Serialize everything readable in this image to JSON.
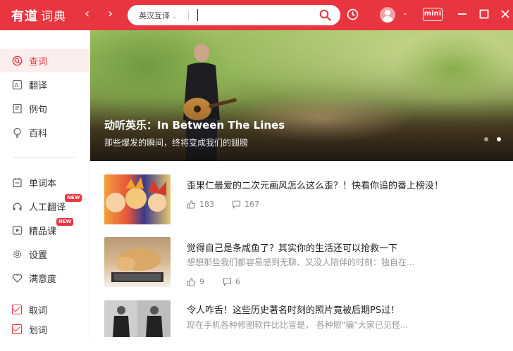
{
  "app": {
    "logo_text": "有道",
    "logo_sub": "词典",
    "back_arrow": "‹",
    "forward_arrow": "›"
  },
  "search": {
    "language": "英汉互译",
    "query": ""
  },
  "toolbar": {
    "mini_label": "mini",
    "user_chevron": "⌄"
  },
  "sidebar": {
    "items": [
      {
        "label": "查词",
        "icon": "search-word-icon",
        "active": true
      },
      {
        "label": "翻译",
        "icon": "translate-icon"
      },
      {
        "label": "例句",
        "icon": "example-icon"
      },
      {
        "label": "百科",
        "icon": "bulb-icon"
      },
      {
        "label": "单词本",
        "icon": "wordbook-icon"
      },
      {
        "label": "人工翻译",
        "icon": "human-translate-icon",
        "badge": "NEW"
      },
      {
        "label": "精品课",
        "icon": "course-icon",
        "badge": "NEW"
      },
      {
        "label": "设置",
        "icon": "gear-icon"
      },
      {
        "label": "满意度",
        "icon": "heart-icon"
      },
      {
        "label": "取词",
        "checked": true
      },
      {
        "label": "划词",
        "checked": true
      }
    ]
  },
  "banner": {
    "title": "动听英乐：In Between The Lines",
    "subtitle": "那些爆发的瞬间，终将变成我们的翅膀",
    "dots": 2,
    "active_dot": 1
  },
  "feed": [
    {
      "title": "歪果仁最爱的二次元画风怎么这么歪？！快看你追的番上榜没！",
      "summary": "",
      "likes": "183",
      "comments": "167"
    },
    {
      "title": "觉得自己是条咸鱼了？其实你的生活还可以抢救一下",
      "summary": "想想那些我们都容易感到无聊、又没人陪伴的时刻：独自在...",
      "likes": "9",
      "comments": "6"
    },
    {
      "title": "令人咋舌！这些历史著名时刻的照片竟被后期PS过！",
      "summary": "现在手机各种修图软件比比皆是， 各种照\"骗\"大家已见怪...",
      "likes": "",
      "comments": ""
    }
  ],
  "colors": {
    "brand": "#e8353f"
  }
}
